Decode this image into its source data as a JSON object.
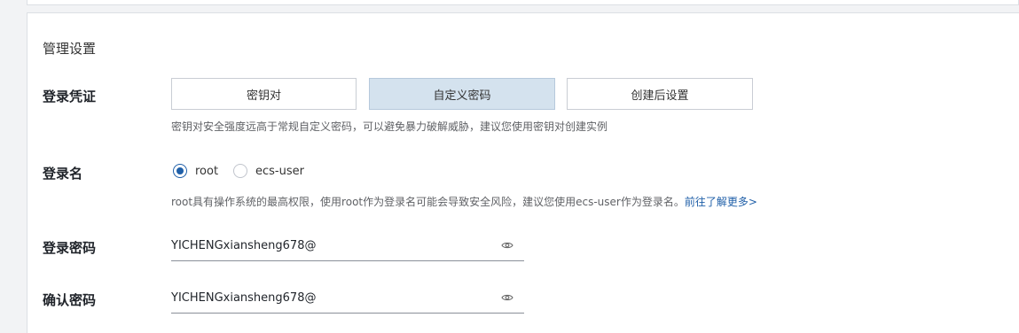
{
  "section": {
    "title": "管理设置"
  },
  "credential": {
    "label": "登录凭证",
    "options": [
      "密钥对",
      "自定义密码",
      "创建后设置"
    ],
    "selected": "自定义密码",
    "hint": "密钥对安全强度远高于常规自定义密码，可以避免暴力破解威胁，建议您使用密钥对创建实例"
  },
  "login_name": {
    "label": "登录名",
    "options": [
      "root",
      "ecs-user"
    ],
    "selected": "root",
    "hint": "root具有操作系统的最高权限，使用root作为登录名可能会导致安全风险，建议您使用ecs-user作为登录名。",
    "link": "前往了解更多>"
  },
  "password": {
    "label": "登录密码",
    "value": "YICHENGxiansheng678@",
    "icon": "eye-icon"
  },
  "confirm_password": {
    "label": "确认密码",
    "value": "YICHENGxiansheng678@",
    "icon": "eye-icon"
  },
  "colors": {
    "accent": "#1f5fa8",
    "selected_bg": "#d4e2ee"
  }
}
